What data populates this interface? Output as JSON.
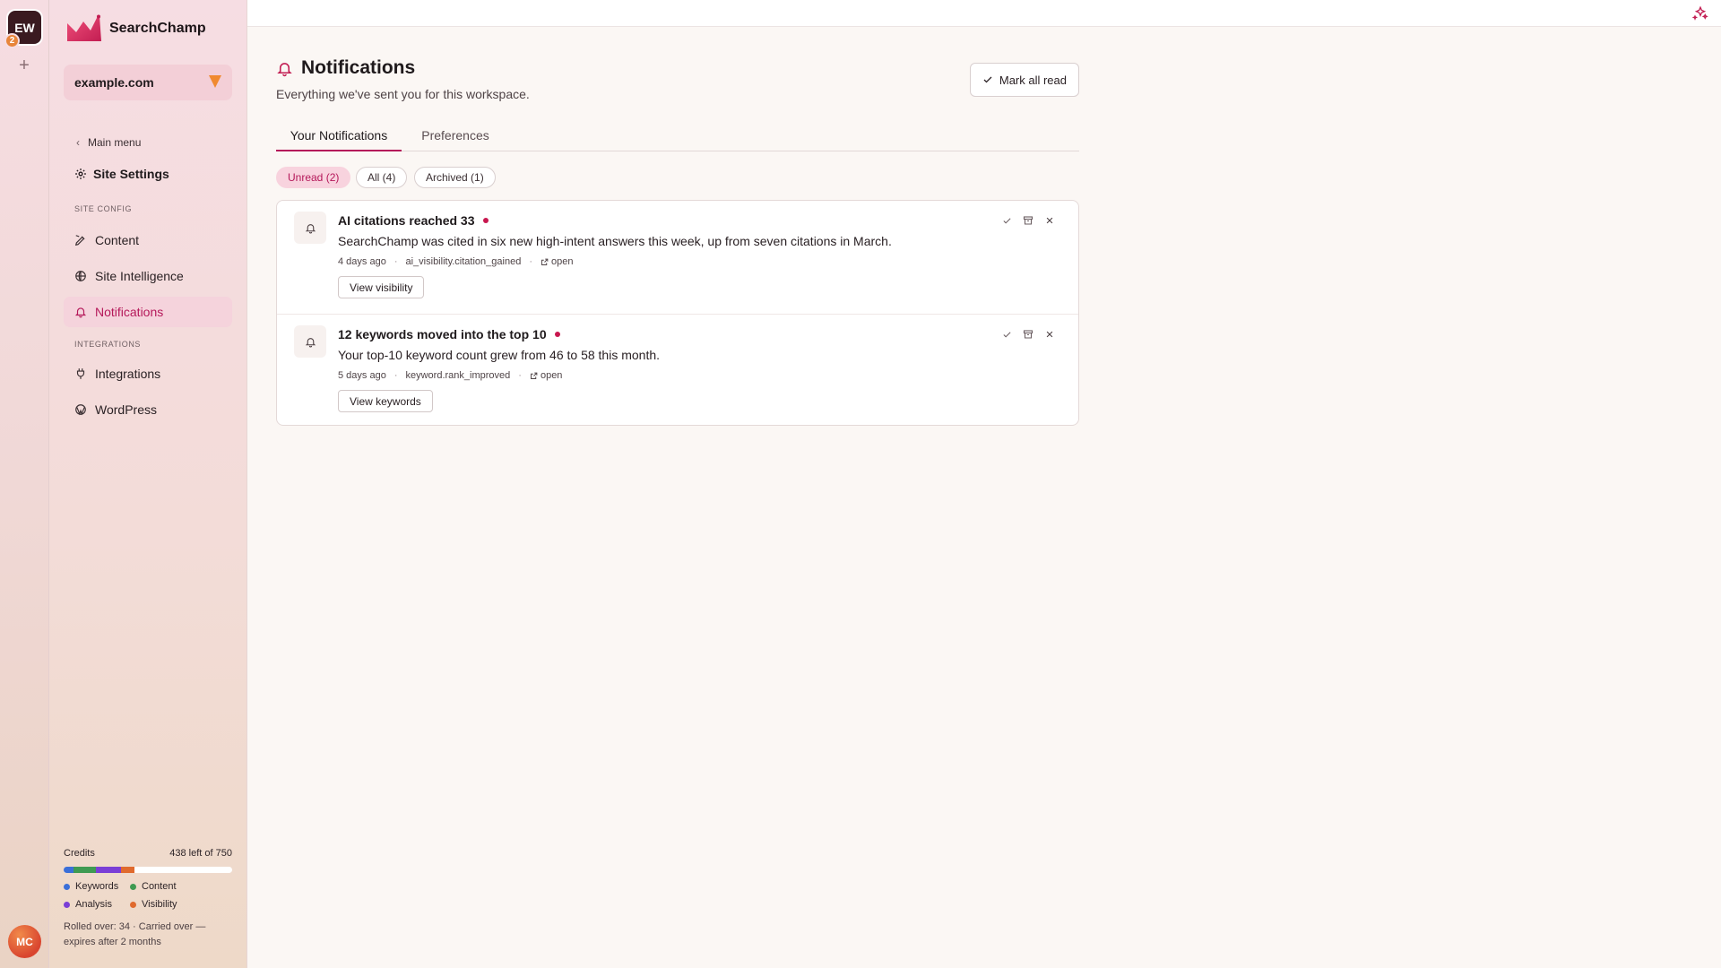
{
  "rail": {
    "workspace_initials": "EW",
    "workspace_badge": "2",
    "add_label": "+",
    "user_initials": "MC"
  },
  "sidebar": {
    "brand_name": "SearchChamp",
    "site_selector": "example.com",
    "back_label": "Main menu",
    "section_title": "Site Settings",
    "group_site_config": "SITE CONFIG",
    "group_integrations": "INTEGRATIONS",
    "items": [
      {
        "label": "Content",
        "icon": "pen-nib-icon"
      },
      {
        "label": "Site Intelligence",
        "icon": "globe-grid-icon"
      },
      {
        "label": "Notifications",
        "icon": "bell-icon",
        "active": true
      },
      {
        "label": "Integrations",
        "icon": "plug-icon"
      },
      {
        "label": "WordPress",
        "icon": "wordpress-icon"
      }
    ],
    "credits": {
      "label": "Credits",
      "remaining": "438 left of 750",
      "breakdown": [
        {
          "name": "Keywords",
          "color": "#3b6fd8",
          "fraction": 0.06
        },
        {
          "name": "Content",
          "color": "#3f9a52",
          "fraction": 0.13
        },
        {
          "name": "Analysis",
          "color": "#7a3ed6",
          "fraction": 0.15
        },
        {
          "name": "Visibility",
          "color": "#e06a2e",
          "fraction": 0.08
        }
      ],
      "rollover_text": "Rolled over: 34 · Carried over — expires after 2 months"
    }
  },
  "header": {
    "title": "Notifications",
    "subtitle": "Everything we've sent you for this workspace.",
    "mark_all_read": "Mark all read"
  },
  "tabs": [
    {
      "label": "Your Notifications",
      "active": true
    },
    {
      "label": "Preferences",
      "active": false
    }
  ],
  "filters": [
    {
      "label": "Unread (2)",
      "active": true
    },
    {
      "label": "All (4)",
      "active": false
    },
    {
      "label": "Archived (1)",
      "active": false
    }
  ],
  "notifications": [
    {
      "title": "AI citations reached 33",
      "body": "SearchChamp was cited in six new high-intent answers this week, up from seven citations in March.",
      "time": "4 days ago",
      "event": "ai_visibility.citation_gained",
      "link": "open",
      "action": "View visibility",
      "unread": true
    },
    {
      "title": "12 keywords moved into the top 10",
      "body": "Your top-10 keyword count grew from 46 to 58 this month.",
      "time": "5 days ago",
      "event": "keyword.rank_improved",
      "link": "open",
      "action": "View keywords",
      "unread": true
    }
  ],
  "colors": {
    "accent": "#b5185a",
    "unread_dot": "#c8174f",
    "site_selector_bg": "#f3cfd7",
    "dropdown_arrow": "#f08a30"
  }
}
